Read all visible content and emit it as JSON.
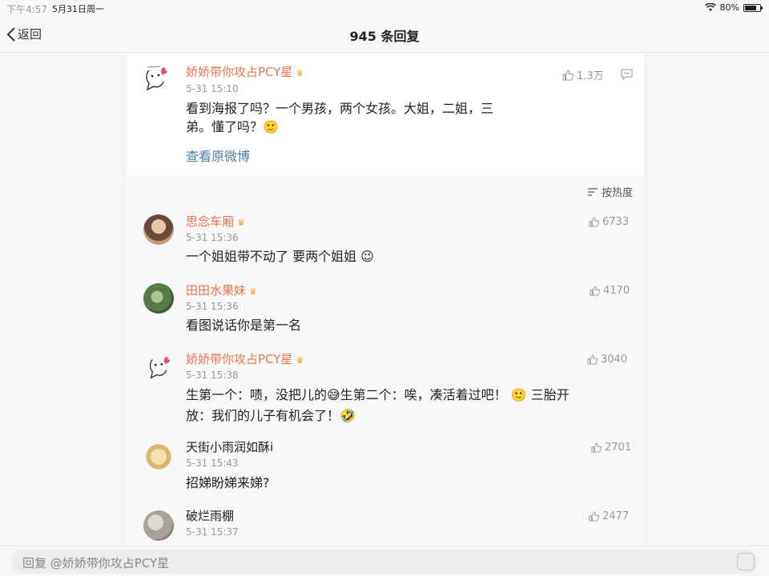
{
  "status": {
    "time": "下午4:57",
    "date": "5月31日周一",
    "battery": "80%",
    "battery_fraction": 0.8
  },
  "nav": {
    "back_label": "返回",
    "title": "945 条回复"
  },
  "post": {
    "username": "娇娇带你攻占PCY星",
    "time": "5-31 15:10",
    "text_line1": "看到海报了吗？一个男孩，两个女孩。大姐，二姐，三",
    "text_line2": "弟。懂了吗？🙂",
    "likes": "1.3万",
    "view_original": "查看原微博"
  },
  "sort": {
    "label": "按热度"
  },
  "comments": [
    {
      "username": "思念车厢",
      "time": "5-31 15:36",
      "text1": "一个姐姐带不动了 要两个姐姐 😉",
      "text2": "",
      "likes": "6733",
      "avatar_color": "#c99a7a"
    },
    {
      "username": "田田水果妹",
      "time": "5-31 15:36",
      "text1": "看图说话你是第一名",
      "text2": "",
      "likes": "4170",
      "avatar_color": "#6f8c5a"
    },
    {
      "username": "娇娇带你攻占PCY星",
      "time": "5-31 15:38",
      "text1": "生第一个：啧，没把儿的😅生第二个：唉，凑活着过吧！ 🙂 三胎开",
      "text2": "放：我们的儿子有机会了！🤣",
      "likes": "3040",
      "avatar_color": "#ffffff"
    },
    {
      "username": "天街小雨润如酥i",
      "time": "5-31 15:43",
      "text1": "招娣盼娣来娣?",
      "text2": "",
      "likes": "2701",
      "avatar_color": "#e8d9a8"
    },
    {
      "username": "破烂雨棚",
      "time": "5-31 15:37",
      "text1": "",
      "text2": "",
      "likes": "2477",
      "avatar_color": "#b8b2a8"
    }
  ],
  "reply": {
    "placeholder": "回复 @娇娇带你攻占PCY星"
  },
  "colors": {
    "username": "#eb7350",
    "link": "#507daf",
    "muted": "#999999"
  }
}
